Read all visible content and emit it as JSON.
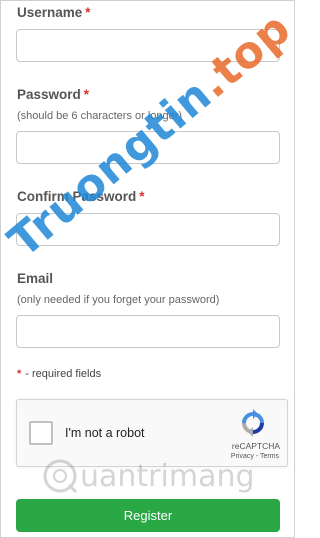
{
  "form": {
    "username": {
      "label": "Username",
      "required_mark": "*",
      "value": ""
    },
    "password": {
      "label": "Password",
      "required_mark": "*",
      "hint": "(should be 6 characters or longer)",
      "value": ""
    },
    "confirm_password": {
      "label": "Confirm Password",
      "required_mark": "*",
      "value": ""
    },
    "email": {
      "label": "Email",
      "hint": "(only needed if you forget your password)",
      "value": ""
    },
    "required_note": {
      "star": "*",
      "text": "- required fields"
    },
    "recaptcha": {
      "checkbox_label": "I'm not a robot",
      "brand": "reCAPTCHA",
      "privacy": "Privacy",
      "separator": "-",
      "terms": "Terms",
      "checked": false
    },
    "register_label": "Register"
  },
  "watermark": {
    "main": "Truongtin",
    "tld": ".top",
    "bottom": "uantrimang"
  },
  "colors": {
    "required": "#d9302c",
    "register_bg": "#2aa846",
    "watermark_blue": "#1e88d6",
    "watermark_orange": "#e86a2b"
  }
}
